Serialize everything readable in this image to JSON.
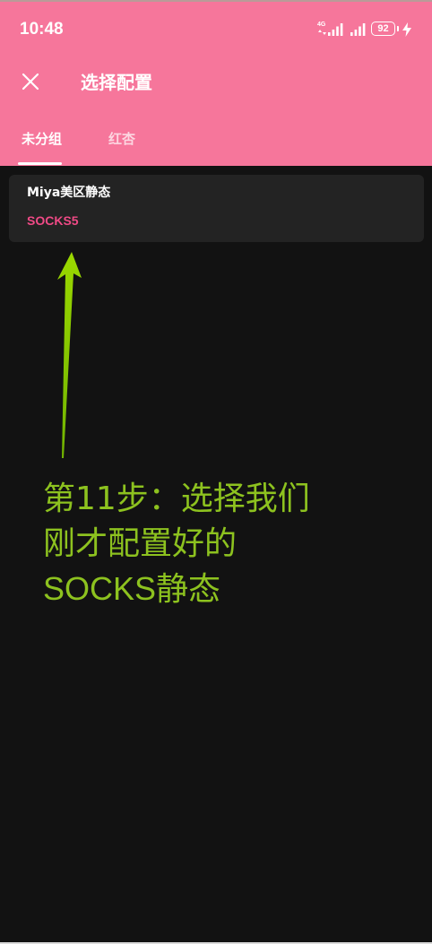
{
  "status_bar": {
    "time": "10:48",
    "network_type": "4G",
    "battery_level": "92",
    "icons": [
      "data-transfer-icon",
      "cellular-signal-icon",
      "cellular-signal-icon",
      "battery-icon",
      "charging-icon"
    ]
  },
  "header": {
    "title": "选择配置",
    "close_icon": "close-icon"
  },
  "tabs": [
    {
      "label": "未分组",
      "selected": true
    },
    {
      "label": "红杏",
      "selected": false
    }
  ],
  "profiles": [
    {
      "name": "Miya美区静态",
      "type": "SOCKS5"
    }
  ],
  "annotation": {
    "lines": [
      "第11步：选择我们",
      "刚才配置好的",
      "SOCKS静态"
    ]
  },
  "colors": {
    "header_background": "#F6769B",
    "page_background": "#121212",
    "card_background": "#232323",
    "profile_type": "#F04A86",
    "annotation": "#8DC21F"
  }
}
